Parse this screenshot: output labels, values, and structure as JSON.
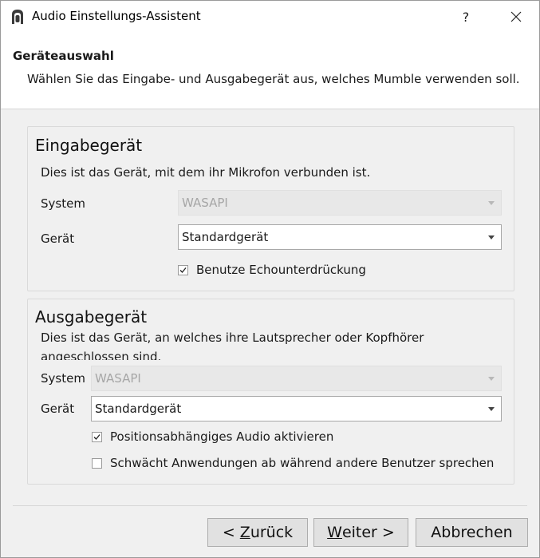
{
  "window": {
    "title": "Audio Einstellungs-Assistent",
    "help_label": "?"
  },
  "header": {
    "title": "Geräteauswahl",
    "subtitle": "Wählen Sie das Eingabe- und Ausgabegerät aus, welches Mumble verwenden soll."
  },
  "input_group": {
    "title": "Eingabegerät",
    "description": "Dies ist das Gerät, mit dem ihr Mikrofon verbunden ist.",
    "system_label": "System",
    "system_value": "WASAPI",
    "device_label": "Gerät",
    "device_value": "Standardgerät",
    "echo_cancel_label": "Benutze Echounterdrückung",
    "echo_cancel_checked": true
  },
  "output_group": {
    "title": "Ausgabegerät",
    "description": "Dies ist das Gerät, an welches ihre Lautsprecher oder Kopfhörer angeschlossen sind.",
    "system_label": "System",
    "system_value": "WASAPI",
    "device_label": "Gerät",
    "device_value": "Standardgerät",
    "positional_audio_label": "Positionsabhängiges Audio aktivieren",
    "positional_audio_checked": true,
    "attenuate_label": "Schwächt Anwendungen ab während andere Benutzer sprechen",
    "attenuate_checked": false
  },
  "buttons": {
    "back_prefix": "< ",
    "back_mnemonic": "Z",
    "back_rest": "urück",
    "next_mnemonic": "W",
    "next_rest": "eiter >",
    "cancel_label": "Abbrechen"
  }
}
